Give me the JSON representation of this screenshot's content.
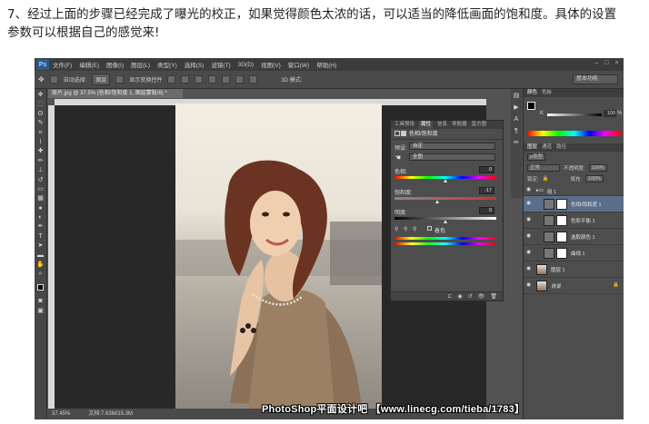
{
  "caption": {
    "line1": "7、经过上面的步骤已经完成了曝光的校正，如果觉得颜色太浓的话，可以适当的降低画面的饱和度。具体的设置",
    "line2": "参数可以根据自己的感觉来!"
  },
  "menubar": {
    "logo": "Ps",
    "items": [
      "文件(F)",
      "编辑(E)",
      "图像(I)",
      "图层(L)",
      "类型(Y)",
      "选择(S)",
      "滤镜(T)",
      "3D(D)",
      "视图(V)",
      "窗口(W)",
      "帮助(H)"
    ]
  },
  "optbar": {
    "auto_select_label": "自动选择:",
    "auto_select_value": "图层",
    "show_transform_label": "显示变换控件",
    "mode_3d_label": "3D 模式:",
    "workspace": "基本功能"
  },
  "document": {
    "tab_label": "原片.jpg @ 37.5% (色相/饱和度 1, 图层蒙版/8) *",
    "zoom": "37.45%",
    "doc_info": "文档:7.63M/15.3M"
  },
  "watermark": "PhotoShop平面设计吧 【www.linecg.com/tieba/1783】",
  "properties": {
    "tabs": [
      "工具预设",
      "属性",
      "信息",
      "导航器",
      "直方图"
    ],
    "active_tab_index": 1,
    "title": "色相/饱和度",
    "preset_label": "预设:",
    "preset_value": "自定",
    "channel_value": "全图",
    "hue_label": "色相:",
    "hue_value": "0",
    "saturation_label": "饱和度:",
    "saturation_value": "-17",
    "lightness_label": "明度:",
    "lightness_value": "0",
    "colorize_label": "着色"
  },
  "color_panel": {
    "tabs": [
      "颜色",
      "色板"
    ],
    "k_label": "K",
    "k_value": "100",
    "k_unit": "%"
  },
  "layers_panel": {
    "tabs": [
      "图层",
      "通道",
      "路径"
    ],
    "kind_value": "ρ类型",
    "blend_mode": "正常",
    "opacity_label": "不透明度:",
    "opacity_value": "100%",
    "lock_label": "锁定:",
    "fill_label": "填充:",
    "fill_value": "100%",
    "layers": [
      {
        "name": "组 1",
        "type": "group"
      },
      {
        "name": "色相/饱和度 1",
        "type": "adjustment",
        "selected": true
      },
      {
        "name": "色彩平衡 1",
        "type": "adjustment"
      },
      {
        "name": "选取颜色 1",
        "type": "adjustment"
      },
      {
        "name": "曲线 1",
        "type": "adjustment"
      },
      {
        "name": "图层 1",
        "type": "pixel"
      },
      {
        "name": "背景",
        "type": "background"
      }
    ]
  },
  "colors": {
    "ps_bg": "#535353",
    "panel_bg": "#4d4d4d",
    "selected_layer": "#5a6e8a"
  }
}
